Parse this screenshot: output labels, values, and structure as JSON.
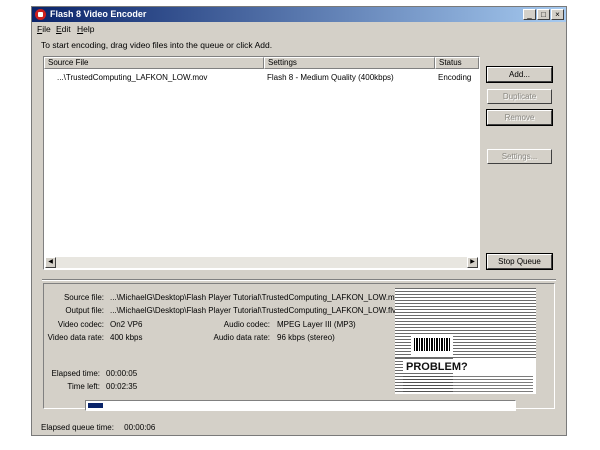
{
  "window": {
    "title": "Flash 8 Video Encoder",
    "controls": {
      "minimize": "_",
      "maximize": "□",
      "close": "×"
    }
  },
  "menu": [
    {
      "key": "F",
      "rest": "ile"
    },
    {
      "key": "E",
      "rest": "dit"
    },
    {
      "key": "H",
      "rest": "elp"
    }
  ],
  "instructions": "To start encoding, drag video files into the queue or click Add.",
  "queue": {
    "headers": {
      "source": "Source File",
      "settings": "Settings",
      "status": "Status"
    },
    "rows": [
      {
        "source": "...\\TrustedComputing_LAFKON_LOW.mov",
        "settings": "Flash 8 - Medium Quality (400kbps)",
        "status": "Encoding"
      }
    ]
  },
  "buttons": {
    "add": "Add...",
    "duplicate": "Duplicate",
    "remove": "Remove",
    "settings": "Settings...",
    "stop_queue": "Stop Queue"
  },
  "details": {
    "source_file_label": "Source file:",
    "source_file": "...\\MichaelG\\Desktop\\Flash Player Tutorial\\TrustedComputing_LAFKON_LOW.mov",
    "output_file_label": "Output file:",
    "output_file": "...\\MichaelG\\Desktop\\Flash Player Tutorial\\TrustedComputing_LAFKON_LOW.flv",
    "video_codec_label": "Video codec:",
    "video_codec": "On2 VP6",
    "audio_codec_label": "Audio codec:",
    "audio_codec": "MPEG Layer III (MP3)",
    "video_rate_label": "Video data rate:",
    "video_rate": "400 kbps",
    "audio_rate_label": "Audio data rate:",
    "audio_rate": "96 kbps (stereo)",
    "elapsed_label": "Elapsed time:",
    "elapsed": "00:00:05",
    "left_label": "Time left:",
    "left": "00:02:35",
    "preview_heading": "PROBLEM?"
  },
  "progress": {
    "fraction": 0.035
  },
  "status_bar": {
    "label": "Elapsed queue time:",
    "value": "00:00:06"
  },
  "colors": {
    "title_start": "#0a246a",
    "title_end": "#a6caf0",
    "progress": "#0a246a"
  }
}
